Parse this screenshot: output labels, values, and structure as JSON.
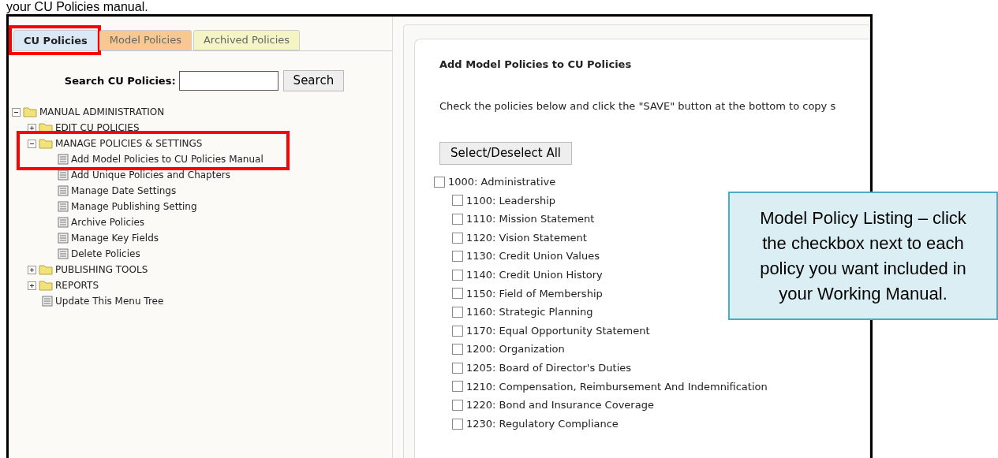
{
  "caption": "your CU Policies manual.",
  "tabs": [
    {
      "label": "CU Policies",
      "selected": true,
      "highlighted": true,
      "color": "#dbe9f6"
    },
    {
      "label": "Model Policies",
      "selected": false,
      "highlighted": false,
      "color": "#f7c88f"
    },
    {
      "label": "Archived Policies",
      "selected": false,
      "highlighted": false,
      "color": "#f4f4c4"
    }
  ],
  "search": {
    "label": "Search CU Policies:",
    "button": "Search"
  },
  "tree": [
    {
      "kind": "folder",
      "label": "MANUAL ADMINISTRATION",
      "expanded": true,
      "highlighted": false,
      "children": [
        {
          "kind": "folder",
          "label": "EDIT CU POLICIES",
          "expanded": false,
          "highlighted": false
        },
        {
          "kind": "folder",
          "label": "MANAGE POLICIES & SETTINGS",
          "expanded": true,
          "highlighted": true,
          "children": [
            {
              "kind": "page",
              "label": "Add Model Policies to CU Policies Manual"
            },
            {
              "kind": "page",
              "label": "Add Unique Policies and Chapters"
            },
            {
              "kind": "page",
              "label": "Manage Date Settings"
            },
            {
              "kind": "page",
              "label": "Manage Publishing Setting"
            },
            {
              "kind": "page",
              "label": "Archive Policies"
            },
            {
              "kind": "page",
              "label": "Manage Key Fields"
            },
            {
              "kind": "page",
              "label": "Delete Policies"
            }
          ]
        },
        {
          "kind": "folder",
          "label": "PUBLISHING TOOLS",
          "expanded": false,
          "highlighted": false
        },
        {
          "kind": "folder",
          "label": "REPORTS",
          "expanded": false,
          "highlighted": false
        },
        {
          "kind": "page",
          "label": "Update This Menu Tree"
        }
      ]
    }
  ],
  "panel": {
    "title": "Add Model Policies to CU Policies",
    "instructions": "Check the policies below and click the \"SAVE\" button at the bottom to copy s",
    "select_all": "Select/Deselect All"
  },
  "policies": [
    {
      "label": "1000: Administrative",
      "checked": false,
      "children": [
        {
          "label": "1100: Leadership",
          "checked": false
        },
        {
          "label": "1110: Mission Statement",
          "checked": false
        },
        {
          "label": "1120: Vision Statement",
          "checked": false
        },
        {
          "label": "1130: Credit Union Values",
          "checked": false
        },
        {
          "label": "1140: Credit Union History",
          "checked": false
        },
        {
          "label": "1150: Field of Membership",
          "checked": false
        },
        {
          "label": "1160: Strategic Planning",
          "checked": false
        },
        {
          "label": "1170: Equal Opportunity Statement",
          "checked": false
        },
        {
          "label": "1200: Organization",
          "checked": false
        },
        {
          "label": "1205: Board of Director's Duties",
          "checked": false
        },
        {
          "label": "1210: Compensation, Reimbursement And Indemnification",
          "checked": false
        },
        {
          "label": "1220: Bond and Insurance Coverage",
          "checked": false
        },
        {
          "label": "1230: Regulatory Compliance",
          "checked": false
        }
      ]
    }
  ],
  "callout": "Model Policy Listing – click the checkbox next to each policy you want included in your Working Manual."
}
